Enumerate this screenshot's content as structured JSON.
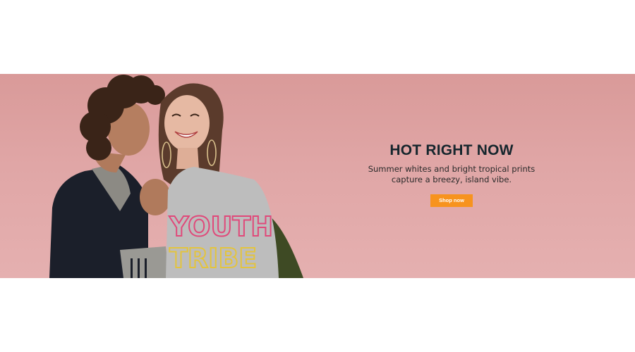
{
  "hero": {
    "headline": "HOT RIGHT NOW",
    "subline_1": "Summer whites and bright tropical prints",
    "subline_2": "capture a breezy, island vibe.",
    "cta_label": "Shop now",
    "photo_print_line_1": "YOUTH",
    "photo_print_line_2": "TRIBE",
    "colors": {
      "background": "#e0a6a6",
      "cta": "#f7931e",
      "headline": "#16262d"
    }
  }
}
